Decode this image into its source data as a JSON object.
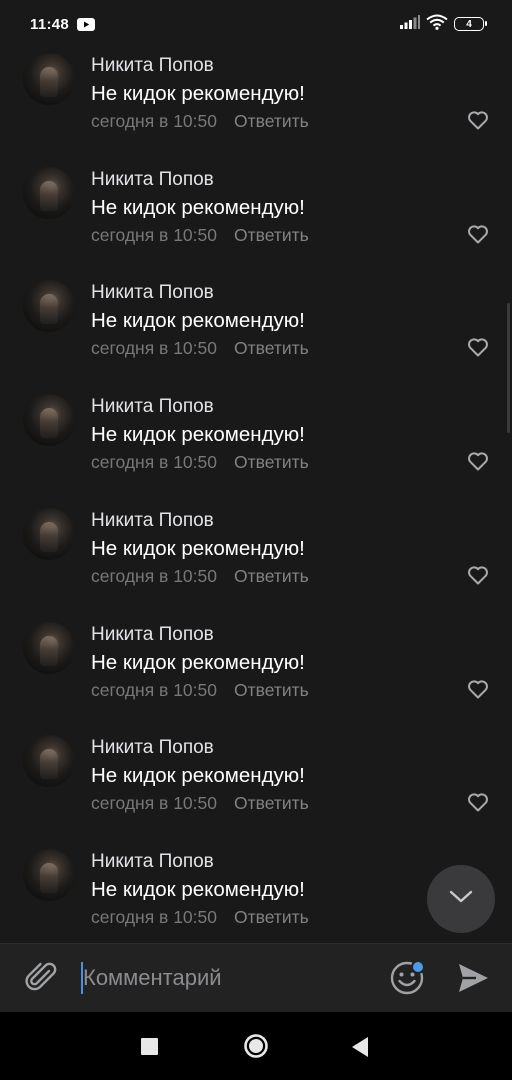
{
  "status_bar": {
    "time": "11:48",
    "battery_level": "4"
  },
  "comments": [
    {
      "author": "Никита Попов",
      "text": "Не кидок рекомендую!",
      "date": "сегодня в 10:50",
      "reply_label": "Ответить"
    },
    {
      "author": "Никита Попов",
      "text": "Не кидок рекомендую!",
      "date": "сегодня в 10:50",
      "reply_label": "Ответить"
    },
    {
      "author": "Никита Попов",
      "text": "Не кидок рекомендую!",
      "date": "сегодня в 10:50",
      "reply_label": "Ответить"
    },
    {
      "author": "Никита Попов",
      "text": "Не кидок рекомендую!",
      "date": "сегодня в 10:50",
      "reply_label": "Ответить"
    },
    {
      "author": "Никита Попов",
      "text": "Не кидок рекомендую!",
      "date": "сегодня в 10:50",
      "reply_label": "Ответить"
    },
    {
      "author": "Никита Попов",
      "text": "Не кидок рекомендую!",
      "date": "сегодня в 10:50",
      "reply_label": "Ответить"
    },
    {
      "author": "Никита Попов",
      "text": "Не кидок рекомендую!",
      "date": "сегодня в 10:50",
      "reply_label": "Ответить"
    },
    {
      "author": "Никита Попов",
      "text": "Не кидок рекомендую!",
      "date": "сегодня в 10:50",
      "reply_label": "Ответить"
    }
  ],
  "composer": {
    "placeholder": "Комментарий",
    "value": ""
  },
  "colors": {
    "background": "#19191a",
    "composer_background": "#222223",
    "accent": "#4a9ce8",
    "secondary_text": "#76787a"
  },
  "icons": {
    "status_app": "youtube-icon",
    "like": "heart-outline-icon",
    "scroll_down": "chevron-down-icon",
    "attach": "paperclip-icon",
    "emoji": "smile-icon",
    "send": "send-icon",
    "nav_recents": "square-icon",
    "nav_home": "circle-icon",
    "nav_back": "triangle-back-icon"
  }
}
